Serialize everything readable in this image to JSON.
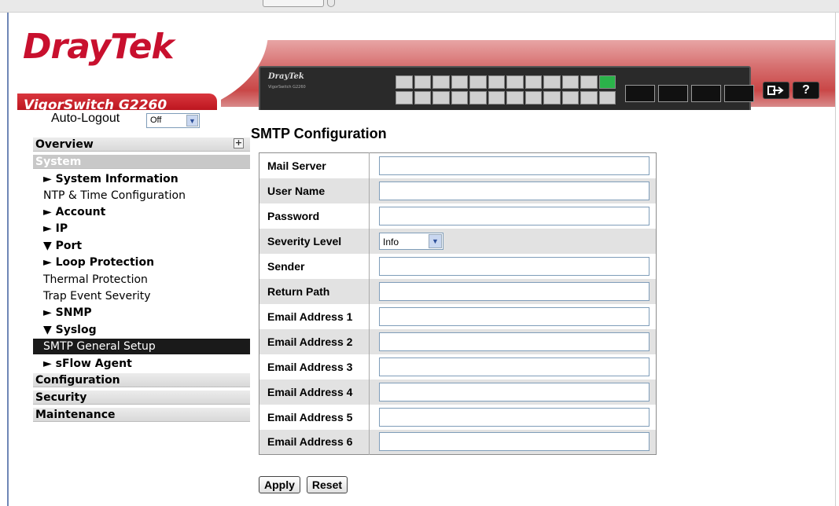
{
  "header": {
    "brand": "DrayTek",
    "model": "VigorSwitch G2260",
    "device_brand": "DrayTek",
    "device_model": "VigorSwitch G2260",
    "logout_icon": "logout-icon",
    "help_label": "?"
  },
  "sidebar": {
    "autologout_label": "Auto-Logout",
    "autologout_value": "Off",
    "sections": {
      "overview": "Overview",
      "system": "System",
      "configuration": "Configuration",
      "security": "Security",
      "maintenance": "Maintenance"
    },
    "items": [
      "► System Information",
      "NTP & Time Configuration",
      "► Account",
      "► IP",
      "▼ Port",
      "► Loop Protection",
      "Thermal Protection",
      "Trap Event Severity",
      "► SNMP",
      "▼ Syslog",
      "SMTP General Setup",
      "► sFlow Agent"
    ]
  },
  "main": {
    "title": "SMTP Configuration",
    "rows": {
      "mail_server": "Mail Server",
      "user_name": "User Name",
      "password": "Password",
      "severity_level": "Severity Level",
      "severity_value": "Info",
      "sender": "Sender",
      "return_path": "Return Path",
      "email1": "Email Address 1",
      "email2": "Email Address 2",
      "email3": "Email Address 3",
      "email4": "Email Address 4",
      "email5": "Email Address 5",
      "email6": "Email Address 6"
    },
    "apply_label": "Apply",
    "reset_label": "Reset"
  },
  "colors": {
    "brand_red": "#c8102e",
    "selected_nav": "#1a1a1a"
  }
}
